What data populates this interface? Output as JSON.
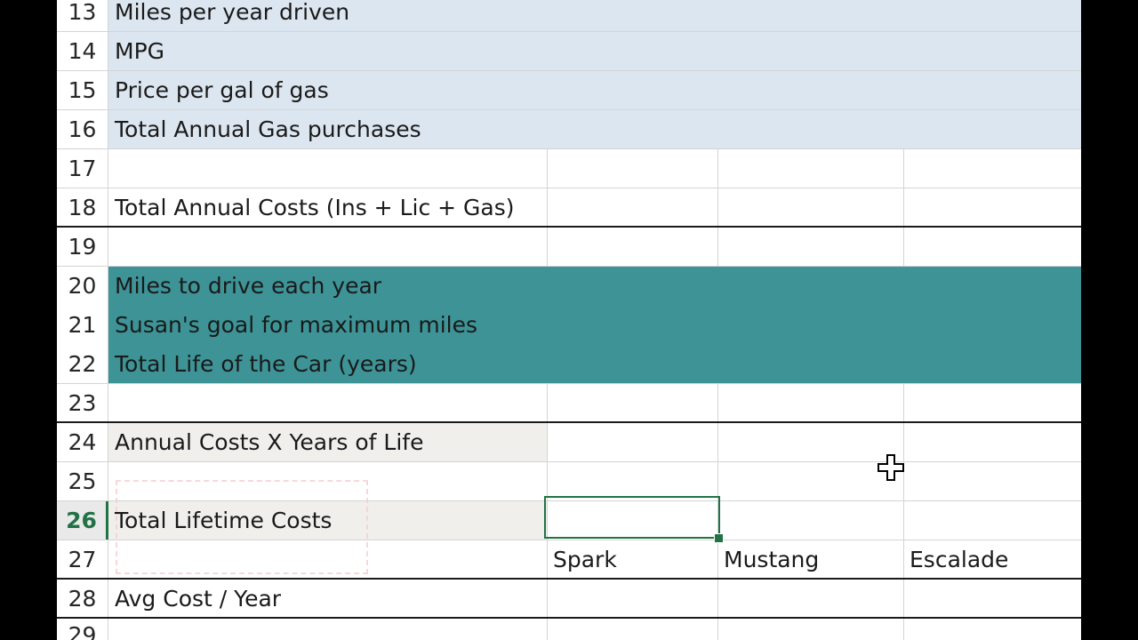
{
  "rows": [
    {
      "num": "13",
      "label": "Miles per year driven"
    },
    {
      "num": "14",
      "label": "MPG"
    },
    {
      "num": "15",
      "label": "Price per gal of gas"
    },
    {
      "num": "16",
      "label": "Total Annual Gas purchases"
    },
    {
      "num": "17",
      "label": ""
    },
    {
      "num": "18",
      "label": "Total Annual Costs (Ins + Lic + Gas)"
    },
    {
      "num": "19",
      "label": ""
    },
    {
      "num": "20",
      "label": "Miles to drive each year"
    },
    {
      "num": "21",
      "label": "Susan's goal for maximum miles"
    },
    {
      "num": "22",
      "label": "Total Life of the Car (years)"
    },
    {
      "num": "23",
      "label": ""
    },
    {
      "num": "24",
      "label": "Annual Costs X Years of Life"
    },
    {
      "num": "25",
      "label": ""
    },
    {
      "num": "26",
      "label": "Total Lifetime Costs"
    },
    {
      "num": "27",
      "label": ""
    },
    {
      "num": "28",
      "label": "Avg Cost / Year"
    },
    {
      "num": "29",
      "label": ""
    }
  ],
  "car_headers": {
    "b": "Spark",
    "c": "Mustang",
    "d": "Escalade"
  },
  "colors": {
    "blue_fill": "#dce6f0",
    "teal_fill": "#3d9396",
    "grey_fill": "#f0efec",
    "selection": "#217346"
  },
  "selected_cell_row": "26"
}
